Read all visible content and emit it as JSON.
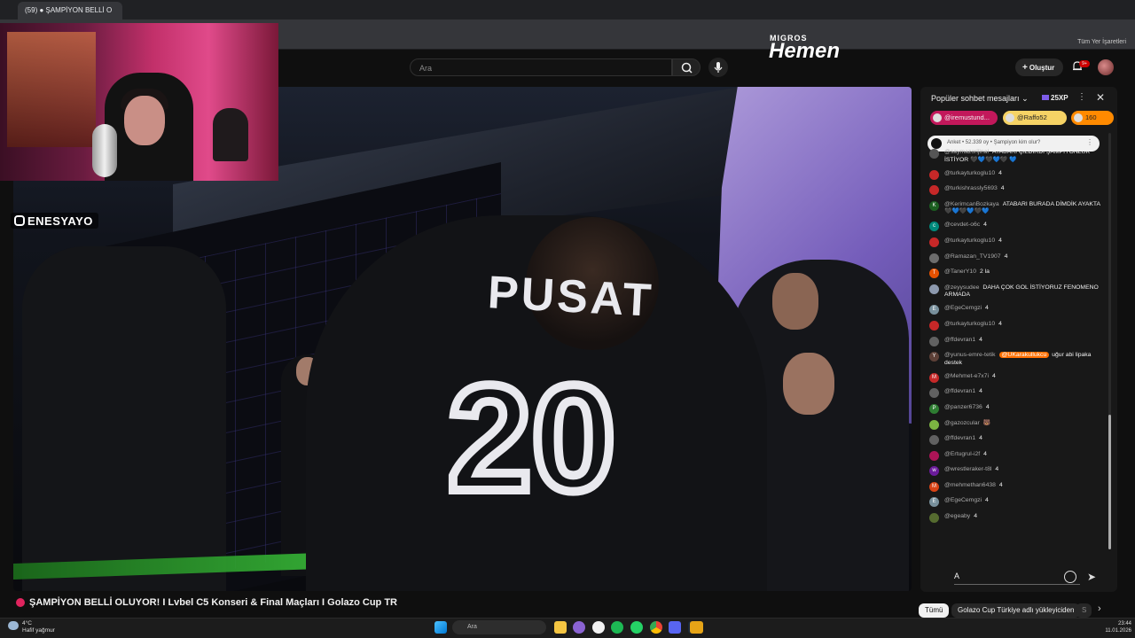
{
  "browser": {
    "tab_title": "(59) ● ŞAMPİYON BELLİ O",
    "bookmarks_label": "Tüm Yer İşaretleri"
  },
  "header": {
    "search_placeholder": "Ara",
    "create_label": "Oluştur",
    "notification_count": "9+"
  },
  "overlay": {
    "handle": "ENESYAYO",
    "banner_brand_top": "MIGROS",
    "banner_brand": "Hemen",
    "shirt_name": "PUSAT",
    "shirt_number": "20"
  },
  "video": {
    "title": "ŞAMPİYON BELLİ OLUYOR! I Lvbel C5 Konseri & Final Maçları I Golazo Cup TR"
  },
  "chat": {
    "header": "Popüler sohbet mesajları",
    "xp": "25XP",
    "pinned": [
      {
        "name": "@iremustund...",
        "color": "#c2185b"
      },
      {
        "name": "@Raffo52",
        "color": "#f6d365"
      },
      {
        "name": "160",
        "color": "#ff8a00"
      }
    ],
    "poll": "Anket • 52.339 oy • Şampiyon kim olur?",
    "messages": [
      {
        "user": "@saymazorijinal",
        "text": "ATABARI ÇILDIRDI ŞAMPİYONLUK İSTİYOR 🖤💙🖤💙🖤 💙",
        "avatar": "#555",
        "initial": ""
      },
      {
        "user": "@turkayturkoglu10",
        "text": "4",
        "avatar": "#c62828",
        "initial": ""
      },
      {
        "user": "@turkishrassly5693",
        "text": "4",
        "avatar": "#c62828",
        "initial": ""
      },
      {
        "user": "@KerimcanBozkaya",
        "text": "ATABARI BURADA DİMDİK AYAKTA 🖤💙🖤💙🖤💙",
        "avatar": "#1b5e20",
        "initial": "K"
      },
      {
        "user": "@cevdet-o6c",
        "text": "4",
        "avatar": "#00897b",
        "initial": "c"
      },
      {
        "user": "@turkayturkoglu10",
        "text": "4",
        "avatar": "#c62828",
        "initial": ""
      },
      {
        "user": "@Ramazan_TV1907",
        "text": "4",
        "avatar": "#6d6d6d",
        "initial": ""
      },
      {
        "user": "@TanerY10",
        "text": "2 la",
        "avatar": "#e65100",
        "initial": "T"
      },
      {
        "user": "@zeyysudee",
        "text": "DAHA ÇOK GOL İSTİYORUZ FENOMENO ARMADA",
        "avatar": "#8d99ae",
        "initial": ""
      },
      {
        "user": "@EgeCemgzi",
        "text": "4",
        "avatar": "#78909c",
        "initial": "E"
      },
      {
        "user": "@turkayturkoglu10",
        "text": "4",
        "avatar": "#c62828",
        "initial": ""
      },
      {
        "user": "@ffdevran1",
        "text": "4",
        "avatar": "#616161",
        "initial": ""
      },
      {
        "user": "@yunus-emre-tetik",
        "mention": "@UKarakullukcu",
        "text": "uğur abi lipaka destek",
        "avatar": "#5d4037",
        "initial": "Y"
      },
      {
        "user": "@Mehmet-e7x7i",
        "text": "4",
        "avatar": "#c62828",
        "initial": "M"
      },
      {
        "user": "@ffdevran1",
        "text": "4",
        "avatar": "#616161",
        "initial": ""
      },
      {
        "user": "@panzer6736",
        "text": "4",
        "avatar": "#2e7d32",
        "initial": "P"
      },
      {
        "user": "@gazozcular",
        "text": "🐻",
        "avatar": "#7cb342",
        "initial": ""
      },
      {
        "user": "@ffdevran1",
        "text": "4",
        "avatar": "#616161",
        "initial": ""
      },
      {
        "user": "@Ertugrul-i2f",
        "text": "4",
        "avatar": "#ad1457",
        "initial": ""
      },
      {
        "user": "@wrestleraker-t8l",
        "text": "4",
        "avatar": "#6a1b9a",
        "initial": "w"
      },
      {
        "user": "@mehmethan6438",
        "text": "4",
        "avatar": "#d84315",
        "initial": "M"
      },
      {
        "user": "@EgeCemgzi",
        "text": "4",
        "avatar": "#78909c",
        "initial": "E"
      },
      {
        "user": "@egeaby",
        "text": "4",
        "avatar": "#556b2f",
        "initial": ""
      }
    ],
    "input_value": "A"
  },
  "chips": {
    "all": "Tümü",
    "related": "Golazo Cup Türkiye adlı yükleyiciden",
    "more": "S"
  },
  "taskbar": {
    "temp": "4°C",
    "weather": "Hafif yağmur",
    "search": "Ara",
    "time": "23:44",
    "date": "11.01.2026"
  }
}
